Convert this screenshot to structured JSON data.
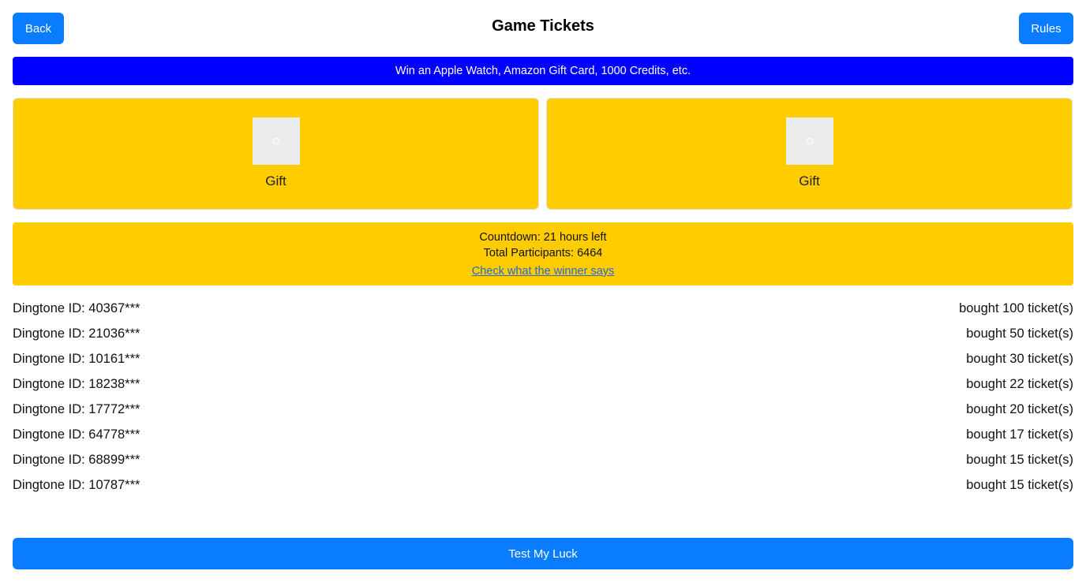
{
  "header": {
    "back_label": "Back",
    "title": "Game Tickets",
    "rules_label": "Rules"
  },
  "banner": {
    "text": "Win an Apple Watch, Amazon Gift Card, 1000 Credits, etc."
  },
  "gifts": [
    {
      "label": "Gift",
      "icon": "gift-image-placeholder"
    },
    {
      "label": "Gift",
      "icon": "gift-image-placeholder"
    }
  ],
  "info": {
    "countdown": "Countdown: 21 hours left",
    "participants": "Total Participants: 6464",
    "winner_link": "Check what the winner says"
  },
  "buyers": [
    {
      "id": "Dingtone ID: 40367***",
      "tickets": "bought 100 ticket(s)"
    },
    {
      "id": "Dingtone ID: 21036***",
      "tickets": "bought 50 ticket(s)"
    },
    {
      "id": "Dingtone ID: 10161***",
      "tickets": "bought 30 ticket(s)"
    },
    {
      "id": "Dingtone ID: 18238***",
      "tickets": "bought 22 ticket(s)"
    },
    {
      "id": "Dingtone ID: 17772***",
      "tickets": "bought 20 ticket(s)"
    },
    {
      "id": "Dingtone ID: 64778***",
      "tickets": "bought 17 ticket(s)"
    },
    {
      "id": "Dingtone ID: 68899***",
      "tickets": "bought 15 ticket(s)"
    },
    {
      "id": "Dingtone ID: 10787***",
      "tickets": "bought 15 ticket(s)"
    }
  ],
  "footer": {
    "luck_label": "Test My Luck"
  },
  "colors": {
    "primary_button": "#0a7cff",
    "banner": "#0000ff",
    "card": "#ffcc00",
    "link": "#2b66d6"
  }
}
